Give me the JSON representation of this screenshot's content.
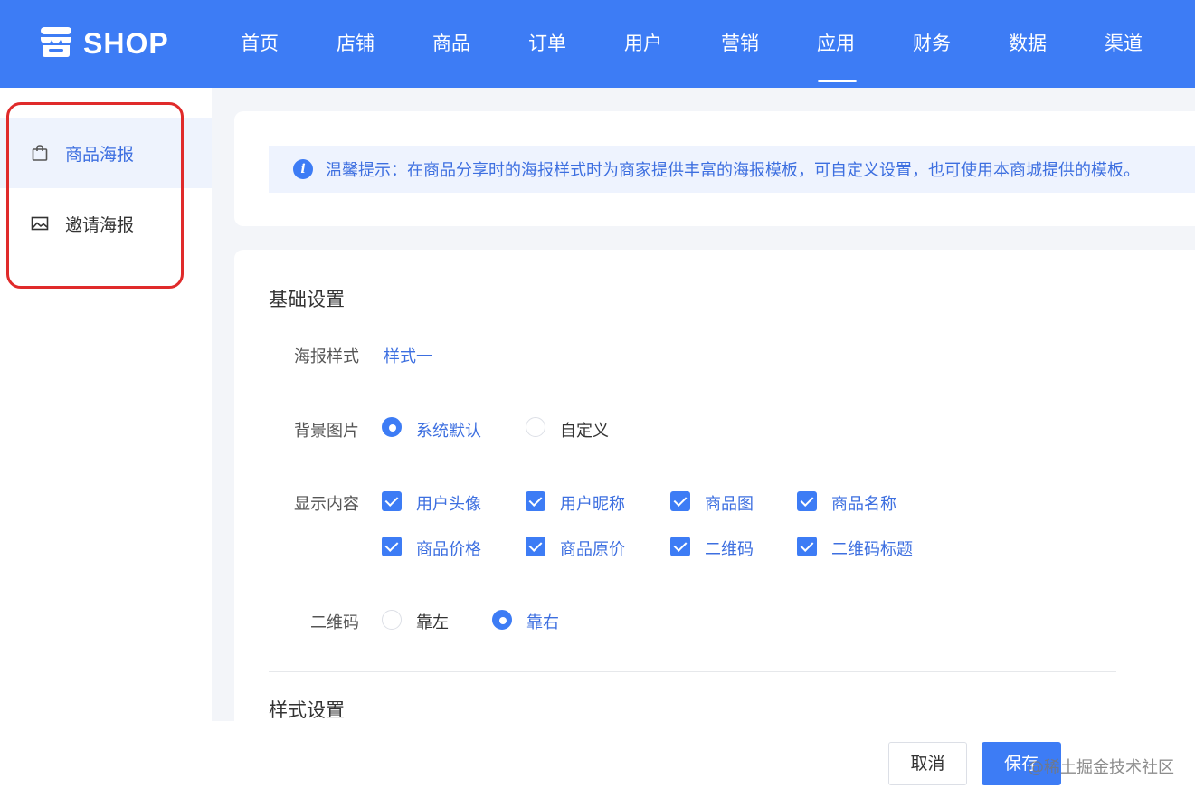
{
  "header": {
    "logo_text": "SHOP",
    "nav": [
      "首页",
      "店铺",
      "商品",
      "订单",
      "用户",
      "营销",
      "应用",
      "财务",
      "数据",
      "渠道"
    ],
    "active_nav": "应用"
  },
  "sidebar": {
    "items": [
      {
        "label": "商品海报",
        "icon": "shopping-bag-icon",
        "active": true
      },
      {
        "label": "邀请海报",
        "icon": "image-icon",
        "active": false
      }
    ]
  },
  "tip": {
    "text": "温馨提示：在商品分享时的海报样式时为商家提供丰富的海报模板，可自定义设置，也可使用本商城提供的模板。"
  },
  "form": {
    "section_basic": "基础设置",
    "poster_style_label": "海报样式",
    "poster_style_value": "样式一",
    "background_label": "背景图片",
    "background_options": [
      {
        "label": "系统默认",
        "selected": true
      },
      {
        "label": "自定义",
        "selected": false
      }
    ],
    "display_label": "显示内容",
    "display_options": [
      {
        "label": "用户头像",
        "checked": true
      },
      {
        "label": "用户昵称",
        "checked": true
      },
      {
        "label": "商品图",
        "checked": true
      },
      {
        "label": "商品名称",
        "checked": true
      },
      {
        "label": "商品价格",
        "checked": true
      },
      {
        "label": "商品原价",
        "checked": true
      },
      {
        "label": "二维码",
        "checked": true
      },
      {
        "label": "二维码标题",
        "checked": true
      }
    ],
    "qrcode_label": "二维码",
    "qrcode_options": [
      {
        "label": "靠左",
        "selected": false
      },
      {
        "label": "靠右",
        "selected": true
      }
    ],
    "section_style": "样式设置"
  },
  "footer": {
    "cancel_label": "取消",
    "save_label": "保存",
    "watermark": "@稀土掘金技术社区"
  },
  "colors": {
    "primary": "#3d7cf5",
    "highlight_outline": "#e02a2a"
  }
}
